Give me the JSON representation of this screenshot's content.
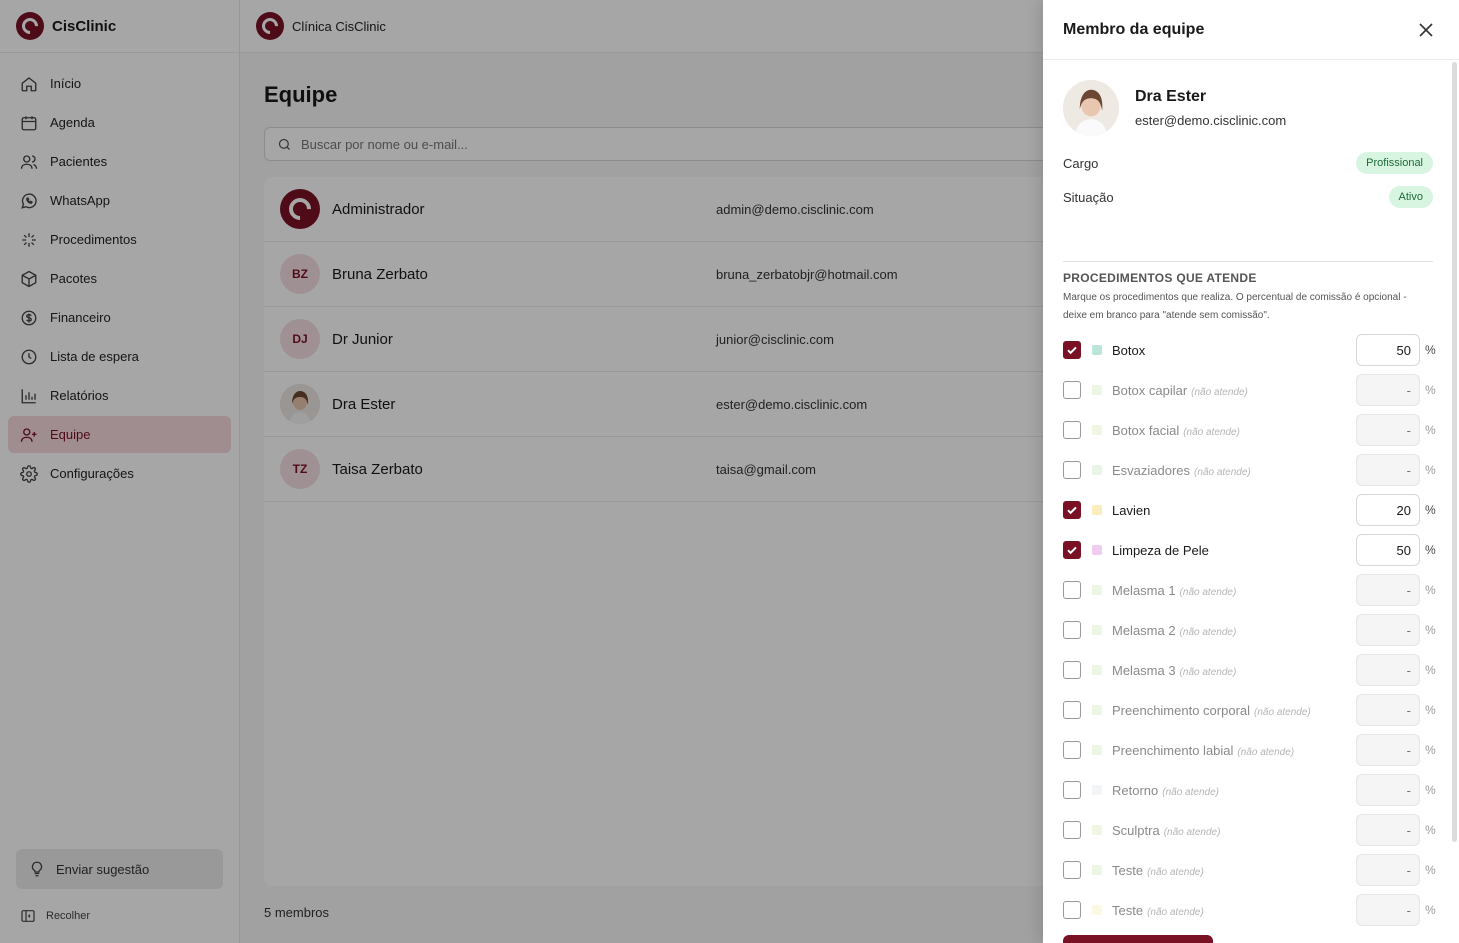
{
  "brand": {
    "name": "CisClinic",
    "clinic_name": "Clínica CisClinic"
  },
  "sidebar": {
    "items": [
      {
        "label": "Início",
        "icon": "home-icon"
      },
      {
        "label": "Agenda",
        "icon": "calendar-icon"
      },
      {
        "label": "Pacientes",
        "icon": "users-icon"
      },
      {
        "label": "WhatsApp",
        "icon": "whatsapp-icon"
      },
      {
        "label": "Procedimentos",
        "icon": "sparkle-icon"
      },
      {
        "label": "Pacotes",
        "icon": "package-icon"
      },
      {
        "label": "Financeiro",
        "icon": "dollar-icon"
      },
      {
        "label": "Lista de espera",
        "icon": "clock-icon"
      },
      {
        "label": "Relatórios",
        "icon": "bar-chart-icon"
      },
      {
        "label": "Equipe",
        "icon": "user-plus-icon",
        "active": true
      },
      {
        "label": "Configurações",
        "icon": "gear-icon"
      }
    ],
    "suggest_label": "Enviar sugestão",
    "collapse_label": "Recolher"
  },
  "main": {
    "title": "Equipe",
    "search_placeholder": "Buscar por nome ou e-mail...",
    "members": [
      {
        "name": "Administrador",
        "email": "admin@demo.cisclinic.com",
        "avatar": "logo"
      },
      {
        "name": "Bruna Zerbato",
        "email": "bruna_zerbatobjr@hotmail.com",
        "initials": "BZ"
      },
      {
        "name": "Dr Junior",
        "email": "junior@cisclinic.com",
        "initials": "DJ"
      },
      {
        "name": "Dra Ester",
        "email": "ester@demo.cisclinic.com",
        "avatar": "photo"
      },
      {
        "name": "Taisa Zerbato",
        "email": "taisa@gmail.com",
        "initials": "TZ"
      }
    ],
    "count_label": "5 membros"
  },
  "drawer": {
    "title": "Membro da equipe",
    "name": "Dra Ester",
    "email": "ester@demo.cisclinic.com",
    "cargo_label": "Cargo",
    "cargo_value": "Profissional",
    "situacao_label": "Situação",
    "situacao_value": "Ativo",
    "section_title": "PROCEDIMENTOS QUE ATENDE",
    "section_desc": "Marque os procedimentos que realiza. O percentual de comissão é opcional - deixe em branco para \"atende sem comissão\".",
    "not_attend_note": "(não atende)",
    "empty_pct": "-",
    "pct_sign": "%",
    "procedures": [
      {
        "name": "Botox",
        "checked": true,
        "pct": "50",
        "color": "#b9e6d8"
      },
      {
        "name": "Botox capilar",
        "checked": false,
        "pct": "",
        "color": "#d4ecc6"
      },
      {
        "name": "Botox facial",
        "checked": false,
        "pct": "",
        "color": "#dcedbf"
      },
      {
        "name": "Esvaziadores",
        "checked": false,
        "pct": "",
        "color": "#cdebcd"
      },
      {
        "name": "Lavien",
        "checked": true,
        "pct": "20",
        "color": "#fbeebc"
      },
      {
        "name": "Limpeza de Pele",
        "checked": true,
        "pct": "50",
        "color": "#f0cdf0"
      },
      {
        "name": "Melasma 1",
        "checked": false,
        "pct": "",
        "color": "#d4ecc6"
      },
      {
        "name": "Melasma 2",
        "checked": false,
        "pct": "",
        "color": "#d4ecc6"
      },
      {
        "name": "Melasma 3",
        "checked": false,
        "pct": "",
        "color": "#d4ecc6"
      },
      {
        "name": "Preenchimento corporal",
        "checked": false,
        "pct": "",
        "color": "#d4ecc6"
      },
      {
        "name": "Preenchimento labial",
        "checked": false,
        "pct": "",
        "color": "#d4ecc6"
      },
      {
        "name": "Retorno",
        "checked": false,
        "pct": "",
        "color": "#e2e6ea"
      },
      {
        "name": "Sculptra",
        "checked": false,
        "pct": "",
        "color": "#dcedbf"
      },
      {
        "name": "Teste",
        "checked": false,
        "pct": "",
        "color": "#d4ecc6"
      },
      {
        "name": "Teste",
        "checked": false,
        "pct": "",
        "color": "#f7efc4"
      }
    ]
  },
  "colors": {
    "accent": "#7a1226",
    "accent_soft": "#f4d9dd",
    "badge_bg": "#d8f5e1",
    "badge_text": "#1d6b3a"
  }
}
